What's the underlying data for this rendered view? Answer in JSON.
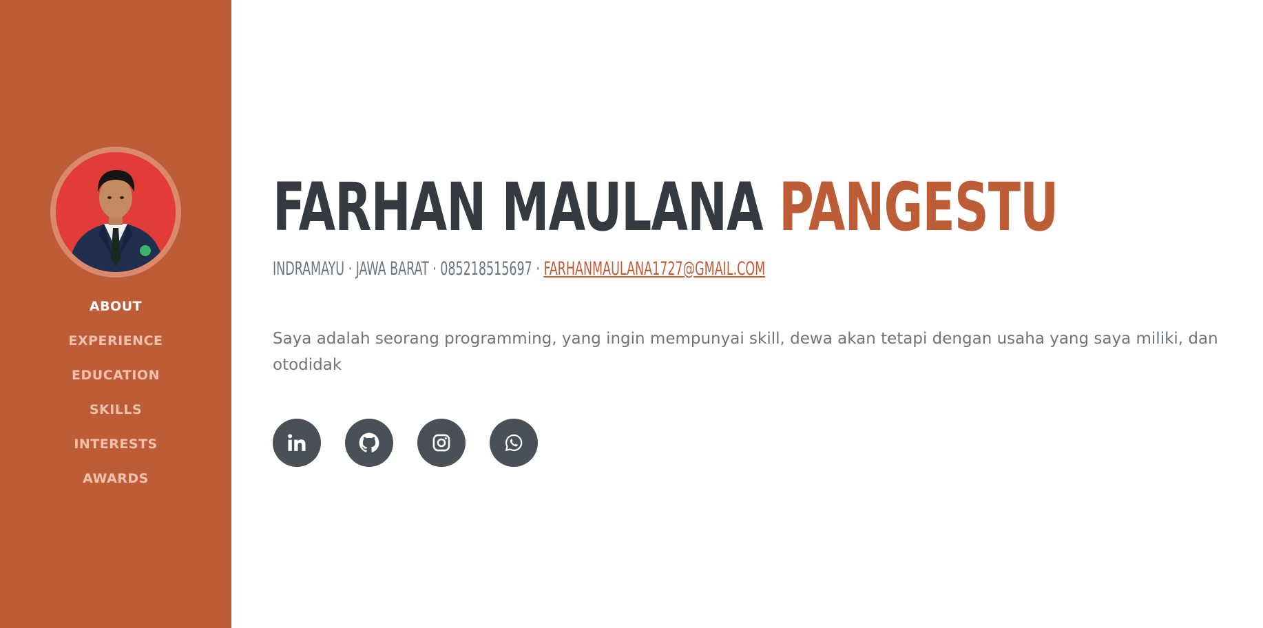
{
  "sidebar": {
    "nav": [
      {
        "label": "ABOUT",
        "active": true
      },
      {
        "label": "EXPERIENCE",
        "active": false
      },
      {
        "label": "EDUCATION",
        "active": false
      },
      {
        "label": "SKILLS",
        "active": false
      },
      {
        "label": "INTERESTS",
        "active": false
      },
      {
        "label": "AWARDS",
        "active": false
      }
    ],
    "background_color": "#bd5d38"
  },
  "about": {
    "first_name": "FARHAN MAULANA",
    "last_name": "PANGESTU",
    "address": "INDRAMAYU · JAWA BARAT · 085218515697 ·",
    "email": "FARHANMAULANA1727@GMAIL.COM",
    "description": "Saya adalah seorang programming, yang ingin mempunyai skill, dewa akan tetapi dengan usaha yang saya miliki, dan otodidak"
  },
  "social": [
    {
      "icon": "linkedin-icon"
    },
    {
      "icon": "github-icon"
    },
    {
      "icon": "instagram-icon"
    },
    {
      "icon": "whatsapp-icon"
    }
  ],
  "colors": {
    "primary": "#bd5d38",
    "dark": "#343a40",
    "muted": "#6c757d",
    "social_bg": "#495057"
  }
}
